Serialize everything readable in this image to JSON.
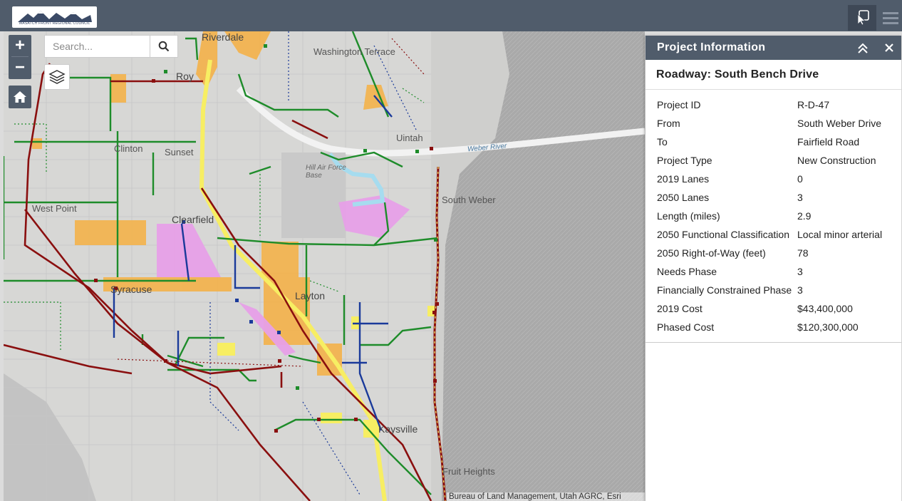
{
  "app": {
    "logo_text": "WASATCH FRONT REGIONAL COUNCIL",
    "header_buttons": [
      "info-cursor-icon",
      "menu-icon"
    ]
  },
  "map": {
    "search": {
      "placeholder": "Search..."
    },
    "zoom_in": "+",
    "zoom_out": "−",
    "attribution": "Bureau of Land Management, Utah AGRC, Esri",
    "labels": {
      "riverdale": "Riverdale",
      "washington_terrace": "Washington Terrace",
      "roy": "Roy",
      "uintah": "Uintah",
      "clinton": "Clinton",
      "sunset": "Sunset",
      "hill_afb": "Hill Air Force Base",
      "south_weber": "South Weber",
      "west_point": "West Point",
      "clearfield": "Clearfield",
      "syracuse": "Syracuse",
      "layton": "Layton",
      "kaysville": "Kaysville",
      "fruit_heights": "Fruit Heights",
      "weber_river": "Weber River"
    },
    "colors": {
      "green_route": "#1e8c2a",
      "red_route": "#8a0f0f",
      "blue_route": "#1a3a9a",
      "orange_area": "#f4b24a",
      "pink_area": "#e7a0e8",
      "yellow_area": "#f7ee63",
      "light_blue": "#a6dcef"
    }
  },
  "panel": {
    "title": "Project Information",
    "subtitle": "Roadway: South Bench Drive",
    "attributes": [
      {
        "label": "Project ID",
        "value": "R-D-47"
      },
      {
        "label": "From",
        "value": "South Weber Drive"
      },
      {
        "label": "To",
        "value": "Fairfield Road"
      },
      {
        "label": "Project Type",
        "value": "New Construction"
      },
      {
        "label": "2019 Lanes",
        "value": "0"
      },
      {
        "label": "2050 Lanes",
        "value": "3"
      },
      {
        "label": "Length (miles)",
        "value": "2.9"
      },
      {
        "label": "2050 Functional Classification",
        "value": "Local minor arterial"
      },
      {
        "label": "2050 Right-of-Way (feet)",
        "value": "78"
      },
      {
        "label": "Needs Phase",
        "value": "3"
      },
      {
        "label": "Financially Constrained Phase",
        "value": "3"
      },
      {
        "label": "2019 Cost",
        "value": "$43,400,000"
      },
      {
        "label": "Phased Cost",
        "value": "$120,300,000"
      }
    ]
  }
}
